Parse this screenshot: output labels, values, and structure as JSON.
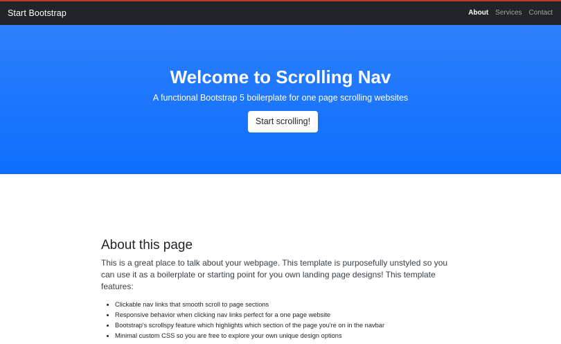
{
  "navbar": {
    "brand": "Start Bootstrap",
    "links": [
      {
        "label": "About",
        "active": true
      },
      {
        "label": "Services",
        "active": false
      },
      {
        "label": "Contact",
        "active": false
      }
    ]
  },
  "hero": {
    "title": "Welcome to Scrolling Nav",
    "subtitle": "A functional Bootstrap 5 boilerplate for one page scrolling websites",
    "button_label": "Start scrolling!"
  },
  "about": {
    "heading": "About this page",
    "lead": "This is a great place to talk about your webpage. This template is purposefully unstyled so you can use it as a boilerplate or starting point for you own landing page designs! This template features:",
    "features": [
      "Clickable nav links that smooth scroll to page sections",
      "Responsive behavior when clicking nav links perfect for a one page website",
      "Bootstrap's scrollspy feature which highlights which section of the page you're on in the navbar",
      "Minimal custom CSS so you are free to explore your own unique design options"
    ]
  },
  "colors": {
    "navbar_bg": "#212529",
    "hero_bg": "#0d6efd",
    "accent_top": "#c0392b"
  }
}
